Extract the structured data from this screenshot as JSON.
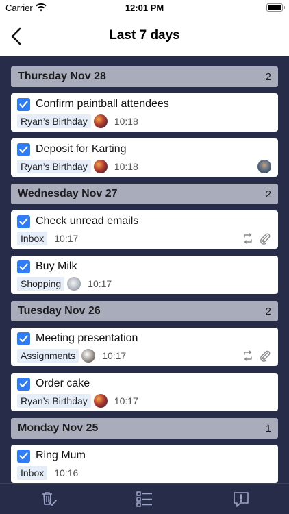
{
  "status_bar": {
    "carrier": "Carrier",
    "time": "12:01 PM"
  },
  "nav": {
    "title": "Last 7 days",
    "back_icon": "chevron-left-icon"
  },
  "sections": [
    {
      "title": "Thursday Nov 28",
      "count": "2",
      "tasks": [
        {
          "title": "Confirm paintball attendees",
          "tag": "Ryan’s Birthday",
          "time": "10:18",
          "completed": true
        },
        {
          "title": "Deposit for Karting",
          "tag": "Ryan’s Birthday",
          "time": "10:18",
          "completed": true,
          "has_assignee": true
        }
      ]
    },
    {
      "title": "Wednesday Nov 27",
      "count": "2",
      "tasks": [
        {
          "title": "Check unread emails",
          "tag": "Inbox",
          "time": "10:17",
          "completed": true,
          "repeat": true,
          "attachment": true
        },
        {
          "title": "Buy Milk",
          "tag": "Shopping",
          "time": "10:17",
          "completed": true
        }
      ]
    },
    {
      "title": "Tuesday Nov 26",
      "count": "2",
      "tasks": [
        {
          "title": "Meeting presentation",
          "tag": "Assignments",
          "time": "10:17",
          "completed": true,
          "repeat": true,
          "attachment": true
        },
        {
          "title": "Order cake",
          "tag": "Ryan’s Birthday",
          "time": "10:17",
          "completed": true
        }
      ]
    },
    {
      "title": "Monday Nov 25",
      "count": "1",
      "tasks": [
        {
          "title": "Ring Mum",
          "tag": "Inbox",
          "time": "10:16",
          "completed": true
        }
      ]
    }
  ],
  "tab_bar": {
    "icons": [
      "trash-check-icon",
      "checklist-icon",
      "alert-message-icon"
    ],
    "accent": "#9aa3c8"
  },
  "colors": {
    "background": "#272c48",
    "section_header": "#a9acbb",
    "checkbox": "#2f7cf6",
    "tag_bg": "#e4edf8"
  }
}
